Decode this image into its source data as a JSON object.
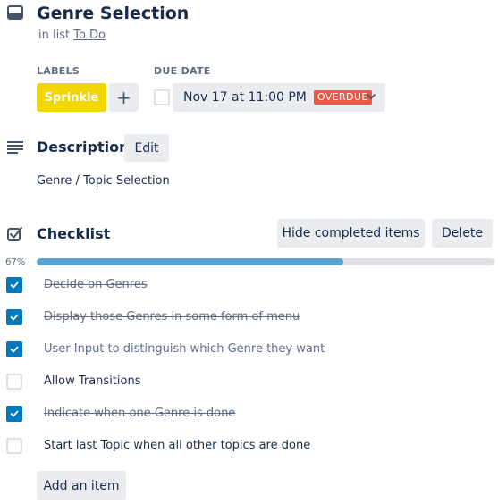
{
  "card": {
    "title": "Genre Selection",
    "in_list_prefix": "in list",
    "list_name": "To Do"
  },
  "labels_section": {
    "heading": "LABELS",
    "labels": [
      {
        "name": "Sprinkle",
        "color": "#f2d600"
      }
    ],
    "add_symbol": "+"
  },
  "due_date": {
    "heading": "DUE DATE",
    "checked": false,
    "value": "Nov 17 at 11:00 PM",
    "status": "OVERDUE",
    "status_color": "#eb5a46"
  },
  "description": {
    "heading": "Description",
    "edit_label": "Edit",
    "text": "Genre / Topic Selection"
  },
  "checklist": {
    "heading": "Checklist",
    "hide_completed_label": "Hide completed items",
    "delete_label": "Delete",
    "progress_text": "67%",
    "progress_fraction": 0.67,
    "items": [
      {
        "text": "Decide on Genres",
        "checked": true
      },
      {
        "text": "Display those Genres in some form of menu",
        "checked": true
      },
      {
        "text": "User Input to distinguish which Genre they want",
        "checked": true
      },
      {
        "text": "Allow Transitions",
        "checked": false
      },
      {
        "text": "Indicate when one Genre is done",
        "checked": true
      },
      {
        "text": "Start last Topic when all other topics are done",
        "checked": false
      }
    ],
    "add_item_label": "Add an item"
  },
  "icons": {
    "card": "card-icon",
    "description": "description-lines-icon",
    "checklist": "checklist-icon",
    "add": "plus-icon",
    "due_dropdown": "chevron-down-icon",
    "check": "checkmark-icon"
  },
  "colors": {
    "accent": "#0079bf",
    "progress": "#5ba4cf",
    "text": "#172b4d",
    "muted": "#5e6c84"
  }
}
